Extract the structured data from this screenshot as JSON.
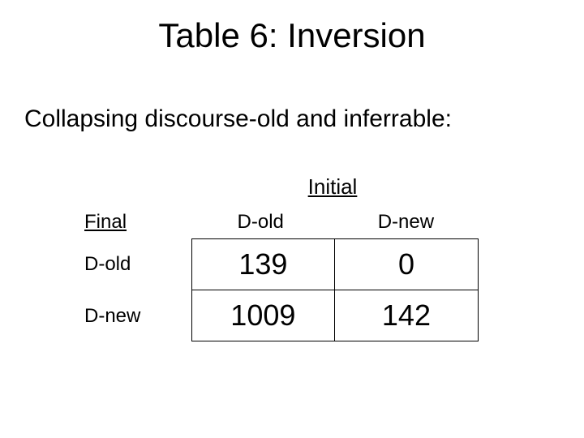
{
  "title": "Table 6: Inversion",
  "subtitle": "Collapsing discourse-old and inferrable:",
  "table": {
    "super_col_header": "Initial",
    "row_axis_label": "Final",
    "col_headers": [
      "D-old",
      "D-new"
    ],
    "row_headers": [
      "D-old",
      "D-new"
    ],
    "rows": [
      {
        "cells": [
          "139",
          "0"
        ]
      },
      {
        "cells": [
          "1009",
          "142"
        ]
      }
    ]
  },
  "chart_data": {
    "type": "table",
    "title": "Table 6: Inversion — Collapsing discourse-old and inferrable",
    "row_dimension": "Final",
    "col_dimension": "Initial",
    "categories_rows": [
      "D-old",
      "D-new"
    ],
    "categories_cols": [
      "D-old",
      "D-new"
    ],
    "values": [
      [
        139,
        0
      ],
      [
        1009,
        142
      ]
    ]
  }
}
